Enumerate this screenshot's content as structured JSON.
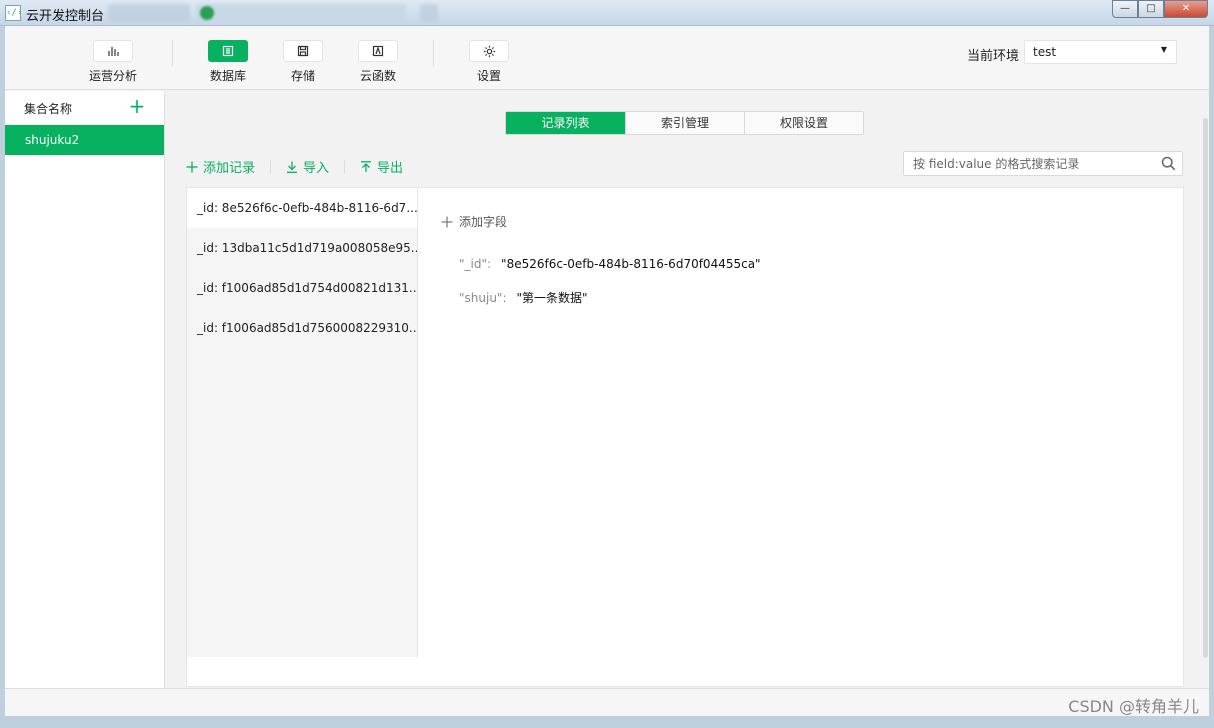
{
  "window": {
    "title": "云开发控制台",
    "logo_text": "‹/›",
    "controls": {
      "minimize": "—",
      "maximize": "□",
      "close": "✕"
    }
  },
  "toolbar": {
    "items": [
      {
        "label": "运营分析",
        "icon": "bar-chart-icon"
      },
      {
        "label": "数据库",
        "icon": "database-icon"
      },
      {
        "label": "存储",
        "icon": "save-icon"
      },
      {
        "label": "云函数",
        "icon": "function-icon"
      },
      {
        "label": "设置",
        "icon": "gear-icon"
      }
    ],
    "env_label": "当前环境",
    "env_value": "test"
  },
  "sidebar": {
    "header": "集合名称",
    "add_symbol": "+",
    "collections": [
      "shujuku2"
    ]
  },
  "tabs": [
    "记录列表",
    "索引管理",
    "权限设置"
  ],
  "actions": {
    "add_record": "添加记录",
    "import": "导入",
    "export": "导出"
  },
  "search": {
    "placeholder": "按 field:value 的格式搜索记录"
  },
  "records": [
    "_id: 8e526f6c-0efb-484b-8116-6d7...",
    "_id: 13dba11c5d1d719a008058e95...",
    "_id: f1006ad85d1d754d00821d131...",
    "_id: f1006ad85d1d7560008229310..."
  ],
  "detail": {
    "add_field": "添加字段",
    "fields": [
      {
        "key": "\"_id\":",
        "value": "\"8e526f6c-0efb-484b-8116-6d70f04455ca\""
      },
      {
        "key": "\"shuju\":",
        "value": "\"第一条数据\""
      }
    ]
  },
  "footer": {
    "watermark": "CSDN @转角羊儿"
  },
  "colors": {
    "accent": "#07b160",
    "background": "#f2f2f2"
  }
}
